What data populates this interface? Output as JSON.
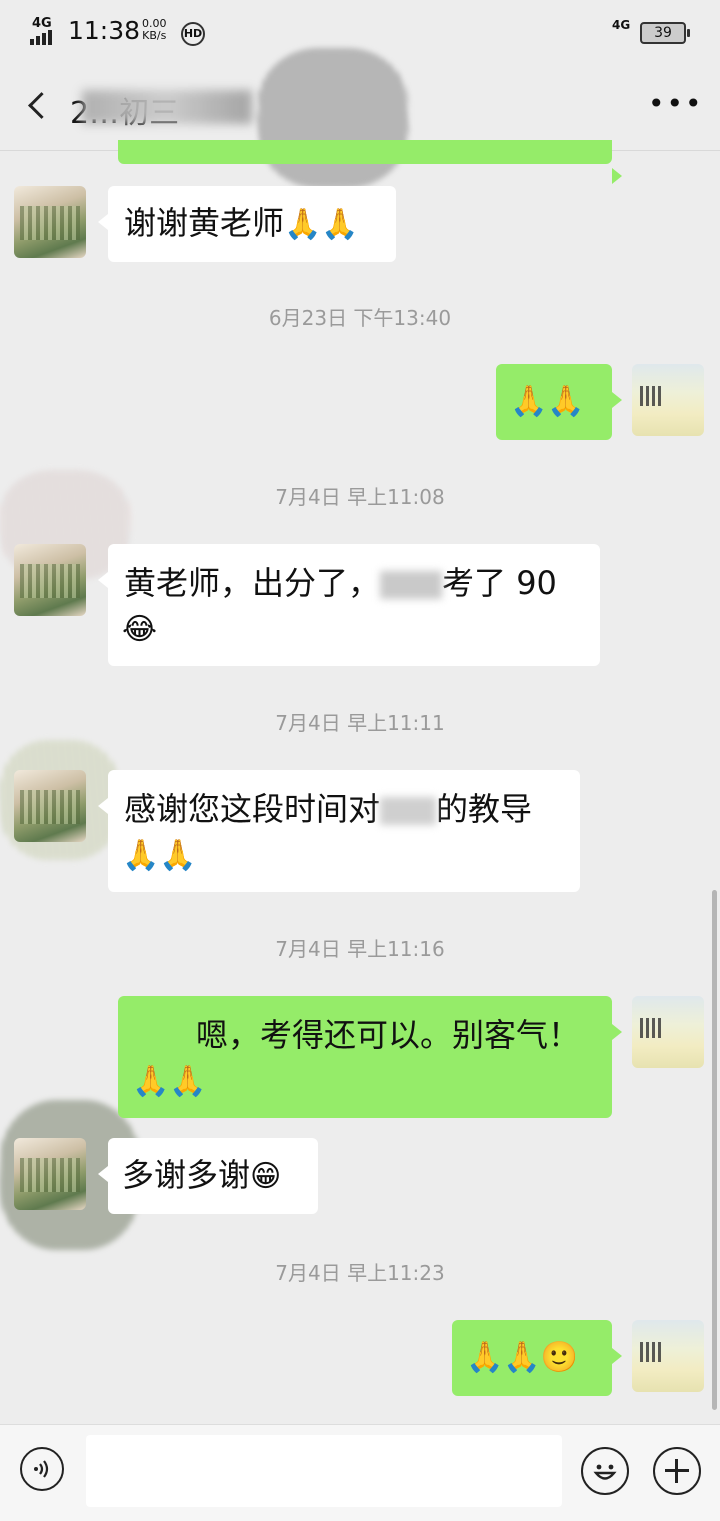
{
  "status_bar": {
    "network_left": "4G",
    "time": "11:38",
    "speed_value": "0.00",
    "speed_unit": "KB/s",
    "hd_badge": "HD",
    "network_right": "4G",
    "battery": "39"
  },
  "header": {
    "title_visible": "2…初三",
    "more_label": "•••"
  },
  "messages": [
    {
      "side": "out",
      "text": "",
      "note": "partially visible bubble"
    },
    {
      "side": "in",
      "text": "谢谢黄老师",
      "emoji": "🙏🙏"
    },
    {
      "timestamp": "6月23日 下午13:40"
    },
    {
      "side": "out",
      "text": "",
      "emoji": "🙏🙏"
    },
    {
      "timestamp": "7月4日 早上11:08"
    },
    {
      "side": "in",
      "text": "黄老师，出分了，",
      "text2": "考了 90",
      "emoji": "😂"
    },
    {
      "timestamp": "7月4日 早上11:11"
    },
    {
      "side": "in",
      "text": "感谢您这段时间对",
      "text2": "的教导",
      "emoji": "🙏🙏"
    },
    {
      "timestamp": "7月4日 早上11:16"
    },
    {
      "side": "out",
      "text": "嗯，考得还可以。别客气！",
      "emoji": "🙏🙏"
    },
    {
      "side": "in",
      "text": "多谢多谢",
      "emoji": "😁"
    },
    {
      "timestamp": "7月4日 早上11:23"
    },
    {
      "side": "out",
      "text": "",
      "emoji": "🙏🙏🙂"
    }
  ],
  "input_bar": {
    "placeholder": ""
  }
}
